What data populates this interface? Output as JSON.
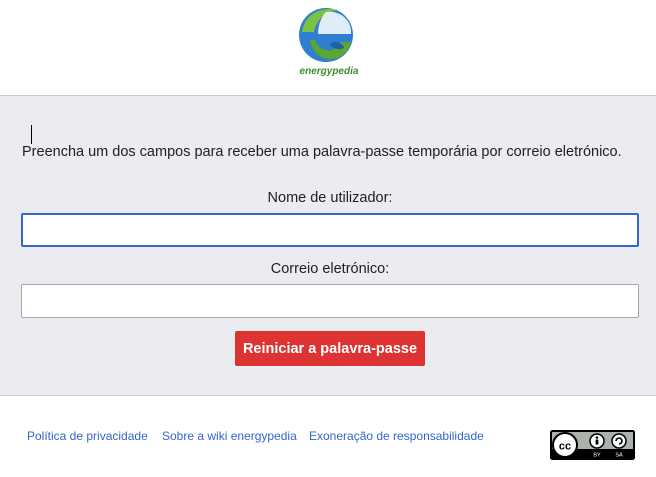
{
  "header": {
    "logo_text": "energypedia"
  },
  "form": {
    "intro": "Preencha um dos campos para receber uma palavra-passe temporária por correio eletrónico.",
    "username_label": "Nome de utilizador:",
    "username_value": "",
    "email_label": "Correio eletrónico:",
    "email_value": "",
    "submit_label": "Reiniciar a palavra-passe"
  },
  "footer": {
    "privacy": "Política de privacidade",
    "about": "Sobre a wiki energypedia",
    "disclaimer": "Exoneração de responsabilidade",
    "license_badge": "cc-by-sa-icon"
  },
  "colors": {
    "accent": "#3366cc",
    "submit": "#dd3333",
    "panel": "#eaecf0"
  }
}
